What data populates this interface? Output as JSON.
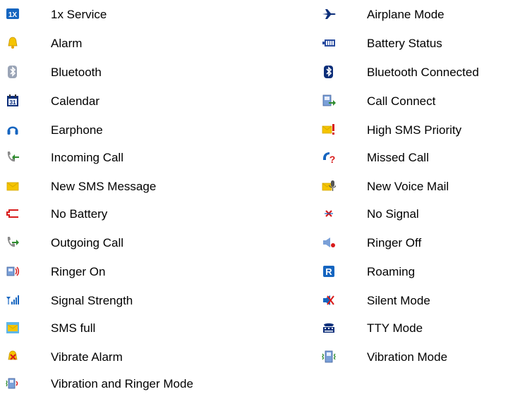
{
  "legend": {
    "left": [
      {
        "label": "1x Service",
        "icon": "1x-service-icon"
      },
      {
        "label": "Alarm",
        "icon": "alarm-bell-icon"
      },
      {
        "label": "Bluetooth",
        "icon": "bluetooth-icon"
      },
      {
        "label": "Calendar",
        "icon": "calendar-icon"
      },
      {
        "label": "Earphone",
        "icon": "earphone-icon"
      },
      {
        "label": "Incoming Call",
        "icon": "incoming-call-icon"
      },
      {
        "label": "New SMS Message",
        "icon": "sms-envelope-icon"
      },
      {
        "label": "No Battery",
        "icon": "empty-battery-icon"
      },
      {
        "label": "Outgoing Call",
        "icon": "outgoing-call-icon"
      },
      {
        "label": "Ringer On",
        "icon": "ringer-on-icon"
      },
      {
        "label": "Signal Strength",
        "icon": "signal-strength-icon"
      },
      {
        "label": "SMS full",
        "icon": "sms-full-icon"
      },
      {
        "label": "Vibrate Alarm",
        "icon": "vibrate-alarm-icon"
      },
      {
        "label": "Vibration and Ringer Mode",
        "icon": "vibration-ringer-icon"
      }
    ],
    "right": [
      {
        "label": "Airplane Mode",
        "icon": "airplane-icon"
      },
      {
        "label": "Battery Status",
        "icon": "battery-status-icon"
      },
      {
        "label": "Bluetooth Connected",
        "icon": "bluetooth-connected-icon"
      },
      {
        "label": "Call Connect",
        "icon": "call-connect-icon"
      },
      {
        "label": "High SMS Priority",
        "icon": "high-sms-priority-icon"
      },
      {
        "label": "Missed Call",
        "icon": "missed-call-icon"
      },
      {
        "label": "New Voice Mail",
        "icon": "voice-mail-icon"
      },
      {
        "label": "No Signal",
        "icon": "no-signal-icon"
      },
      {
        "label": "Ringer Off",
        "icon": "ringer-off-icon"
      },
      {
        "label": "Roaming",
        "icon": "roaming-icon"
      },
      {
        "label": "Silent Mode",
        "icon": "silent-mode-icon"
      },
      {
        "label": "TTY Mode",
        "icon": "tty-mode-icon"
      },
      {
        "label": "Vibration Mode",
        "icon": "vibration-mode-icon"
      }
    ]
  },
  "colors": {
    "blue": "#1565c0",
    "navy": "#0d2f7a",
    "yellow": "#f5c400",
    "orange": "#e8a400",
    "green": "#2e8b2e",
    "red": "#d81b1b",
    "gray": "#8a8a8a"
  }
}
